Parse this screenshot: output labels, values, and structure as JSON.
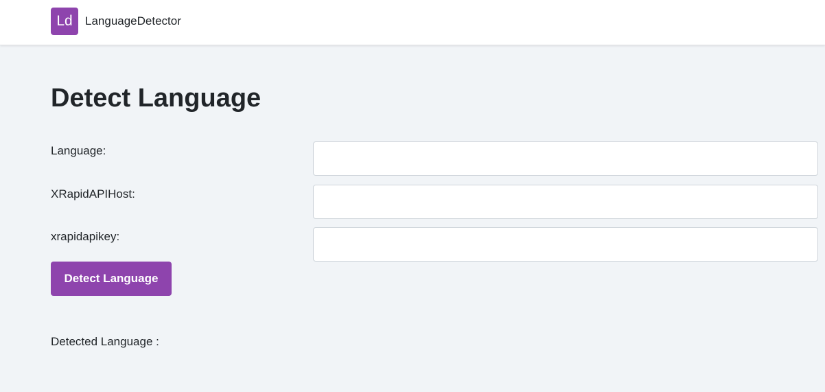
{
  "navbar": {
    "logo_text": "Ld",
    "brand": "LanguageDetector"
  },
  "main": {
    "title": "Detect Language",
    "form": {
      "language_label": "Language:",
      "language_value": "",
      "host_label": "XRapidAPIHost:",
      "host_value": "",
      "key_label": "xrapidapikey:",
      "key_value": "",
      "submit_label": "Detect Language"
    },
    "result": {
      "label": "Detected Language :",
      "value": ""
    }
  },
  "colors": {
    "accent": "#8e44ad",
    "page_background": "#f1f4f7",
    "navbar_background": "#ffffff",
    "text": "#212529"
  }
}
